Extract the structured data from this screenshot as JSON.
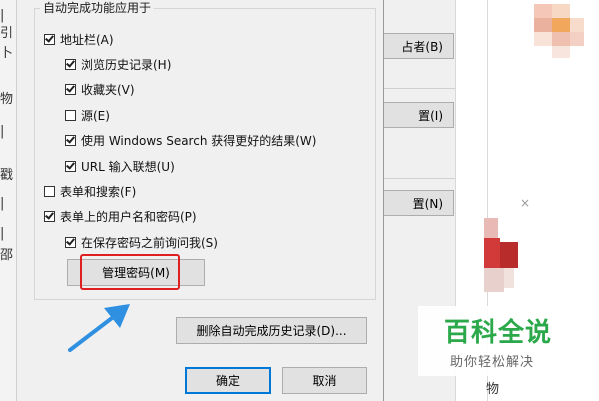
{
  "background": {
    "buttons": [
      "占者(B)",
      "置(I)",
      "置(N)"
    ],
    "left_strip_chars": [
      "|",
      "引",
      "卜",
      "物",
      "|",
      "戳",
      "|",
      "|",
      "邵"
    ],
    "bottom_right_char": "物",
    "close_glyph": "×"
  },
  "dialog": {
    "group_title": "自动完成功能应用于",
    "options": [
      {
        "label": "地址栏(A)",
        "checked": true
      },
      {
        "label": "浏览历史记录(H)",
        "checked": true
      },
      {
        "label": "收藏夹(V)",
        "checked": true
      },
      {
        "label": "源(E)",
        "checked": false
      },
      {
        "label": "使用 Windows Search 获得更好的结果(W)",
        "checked": true
      },
      {
        "label": "URL 输入联想(U)",
        "checked": true
      },
      {
        "label": "表单和搜索(F)",
        "checked": false
      },
      {
        "label": "表单上的用户名和密码(P)",
        "checked": true
      },
      {
        "label": "在保存密码之前询问我(S)",
        "checked": true
      }
    ],
    "manage_passwords_label": "管理密码(M)",
    "delete_history_label": "删除自动完成历史记录(D)...",
    "ok_label": "确定",
    "cancel_label": "取消"
  },
  "watermark": {
    "title": "百科全说",
    "subtitle": "助你轻松解决"
  },
  "colors": {
    "highlight": "#e02020",
    "arrow": "#2f8fe0",
    "watermark_green": "#2aa84a",
    "primary_border": "#0078d7"
  }
}
